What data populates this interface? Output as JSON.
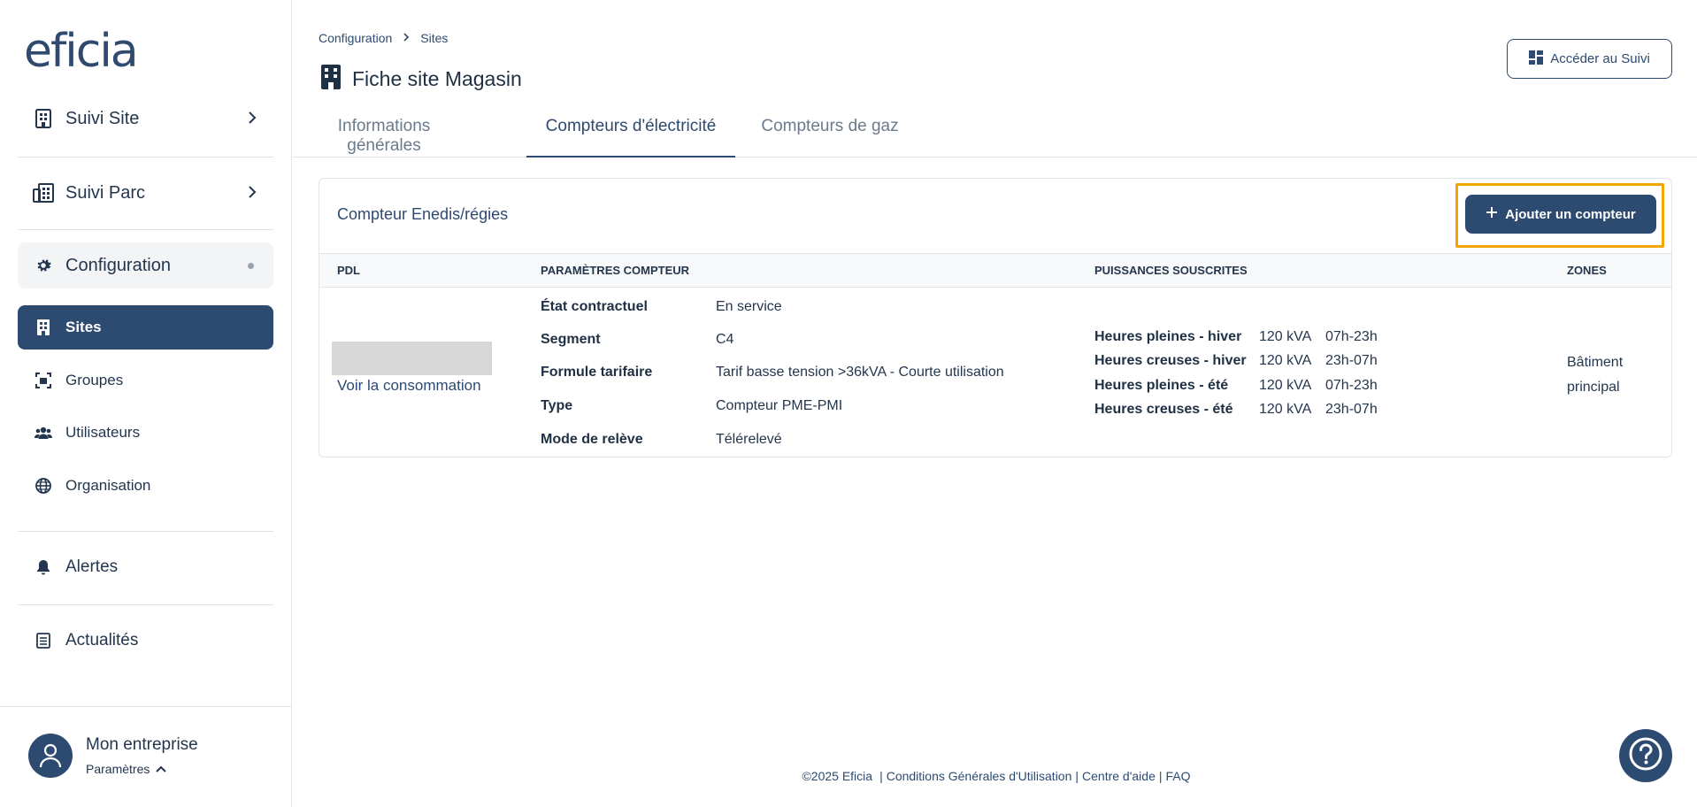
{
  "brand": {
    "logo_text": "eficia"
  },
  "sidebar": {
    "items": [
      {
        "label": "Suivi Site",
        "icon": "building-icon"
      },
      {
        "label": "Suivi Parc",
        "icon": "buildings-icon"
      },
      {
        "label": "Configuration",
        "icon": "gear-icon"
      }
    ],
    "sub_items": [
      {
        "label": "Sites",
        "icon": "building-icon",
        "active": true
      },
      {
        "label": "Groupes",
        "icon": "group-scan-icon"
      },
      {
        "label": "Utilisateurs",
        "icon": "users-icon"
      },
      {
        "label": "Organisation",
        "icon": "globe-icon"
      }
    ],
    "bottom_items": [
      {
        "label": "Alertes",
        "icon": "bell-icon"
      },
      {
        "label": "Actualités",
        "icon": "news-icon"
      }
    ],
    "user": {
      "name": "Mon entreprise",
      "params_label": "Paramètres"
    }
  },
  "header": {
    "breadcrumb": [
      "Configuration",
      "Sites"
    ],
    "title": "Fiche site Magasin",
    "suivi_button": "Accéder au Suivi"
  },
  "tabs": [
    {
      "label": "Informations générales",
      "active": false
    },
    {
      "label": "Compteurs d'électricité",
      "active": true
    },
    {
      "label": "Compteurs de gaz",
      "active": false
    }
  ],
  "card": {
    "title": "Compteur Enedis/régies",
    "add_button": "Ajouter un compteur",
    "columns": [
      "PDL",
      "PARAMÈTRES COMPTEUR",
      "PUISSANCES SOUSCRITES",
      "ZONES"
    ],
    "pdl_link": "Voir la consommation",
    "params": [
      {
        "label": "État contractuel",
        "value": "En service"
      },
      {
        "label": "Segment",
        "value": "C4"
      },
      {
        "label": "Formule tarifaire",
        "value": "Tarif basse tension >36kVA - Courte utilisation"
      },
      {
        "label": "Type",
        "value": "Compteur PME-PMI"
      },
      {
        "label": "Mode de relève",
        "value": "Télérelevé"
      }
    ],
    "powers": [
      {
        "label": "Heures pleines - hiver",
        "kva": "120 kVA",
        "hours": "07h-23h"
      },
      {
        "label": "Heures creuses - hiver",
        "kva": "120 kVA",
        "hours": "23h-07h"
      },
      {
        "label": "Heures pleines - été",
        "kva": "120 kVA",
        "hours": "07h-23h"
      },
      {
        "label": "Heures creuses - été",
        "kva": "120 kVA",
        "hours": "23h-07h"
      }
    ],
    "zone": "Bâtiment principal"
  },
  "footer": {
    "copyright": "©2025 Eficia",
    "links": [
      "Conditions Générales d'Utilisation",
      "Centre d'aide",
      "FAQ"
    ],
    "separator": "|"
  },
  "colors": {
    "primary": "#2d4a70",
    "highlight": "#f5a500",
    "text": "#24364e"
  }
}
